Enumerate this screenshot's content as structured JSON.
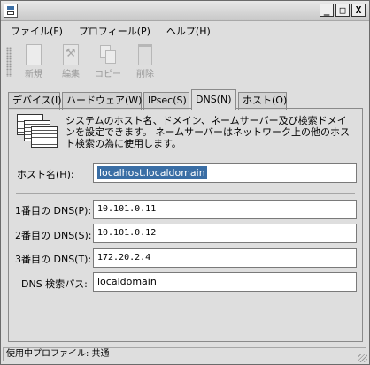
{
  "window": {
    "minimize_glyph": "_",
    "maximize_glyph": "□",
    "close_glyph": "X"
  },
  "menubar": {
    "items": [
      {
        "label": "ファイル(F)"
      },
      {
        "label": "プロフィール(P)"
      },
      {
        "label": "ヘルプ(H)"
      }
    ]
  },
  "toolbar": {
    "new_label": "新規",
    "edit_label": "編集",
    "copy_label": "コピー",
    "delete_label": "削除"
  },
  "tabs": [
    {
      "label": "デバイス(I)"
    },
    {
      "label": "ハードウェア(W)"
    },
    {
      "label": "IPsec(S)"
    },
    {
      "label": "DNS(N)"
    },
    {
      "label": "ホスト(O)"
    }
  ],
  "dns": {
    "description": "システムのホスト名、ドメイン、ネームサーバー及び検索ドメインを設定できます。 ネームサーバーはネットワーク上の他のホスト検索の為に使用します。",
    "hostname_label": "ホスト名(H):",
    "hostname_value": "localhost.localdomain",
    "dns1_label": "1番目の DNS(P):",
    "dns1_value": "10.101.0.11",
    "dns2_label": "2番目の DNS(S):",
    "dns2_value": "10.101.0.12",
    "dns3_label": "3番目の DNS(T):",
    "dns3_value": "172.20.2.4",
    "search_label": "DNS 検索パス:",
    "search_value": "localdomain"
  },
  "status": {
    "text": "使用中プロファイル: 共通"
  }
}
